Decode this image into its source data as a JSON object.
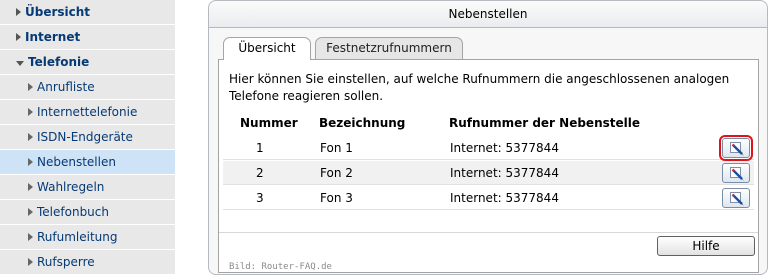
{
  "sidebar": {
    "top_items": [
      {
        "label": "Übersicht",
        "expanded": false
      },
      {
        "label": "Internet",
        "expanded": false
      },
      {
        "label": "Telefonie",
        "expanded": true
      }
    ],
    "sub_items": [
      {
        "label": "Anrufliste",
        "active": false
      },
      {
        "label": "Internettelefonie",
        "active": false
      },
      {
        "label": "ISDN-Endgeräte",
        "active": false
      },
      {
        "label": "Nebenstellen",
        "active": true
      },
      {
        "label": "Wahlregeln",
        "active": false
      },
      {
        "label": "Telefonbuch",
        "active": false
      },
      {
        "label": "Rufumleitung",
        "active": false
      },
      {
        "label": "Rufsperre",
        "active": false
      }
    ]
  },
  "panel": {
    "title": "Nebenstellen",
    "tabs": [
      {
        "label": "Übersicht",
        "active": true
      },
      {
        "label": "Festnetzrufnummern",
        "active": false
      }
    ],
    "intro": "Hier können Sie einstellen, auf welche Rufnummern die angeschlossenen analogen Telefone reagieren sollen.",
    "table": {
      "headers": [
        "Nummer",
        "Bezeichnung",
        "Rufnummer der Nebenstelle"
      ],
      "rows": [
        {
          "nummer": "1",
          "bezeichnung": "Fon 1",
          "rufnummer": "Internet: 5377844",
          "highlighted": true
        },
        {
          "nummer": "2",
          "bezeichnung": "Fon 2",
          "rufnummer": "Internet: 5377844",
          "highlighted": false
        },
        {
          "nummer": "3",
          "bezeichnung": "Fon 3",
          "rufnummer": "Internet: 5377844",
          "highlighted": false
        }
      ]
    },
    "help_label": "Hilfe",
    "credit": "Bild: Router-FAQ.de"
  },
  "icons": {
    "edit": "edit-pencil-icon",
    "expand": "triangle-right-icon",
    "expanded": "triangle-down-icon"
  },
  "colors": {
    "nav_text": "#063a74",
    "active_nav": "#cfe3f7",
    "highlight": "#e0121a"
  }
}
